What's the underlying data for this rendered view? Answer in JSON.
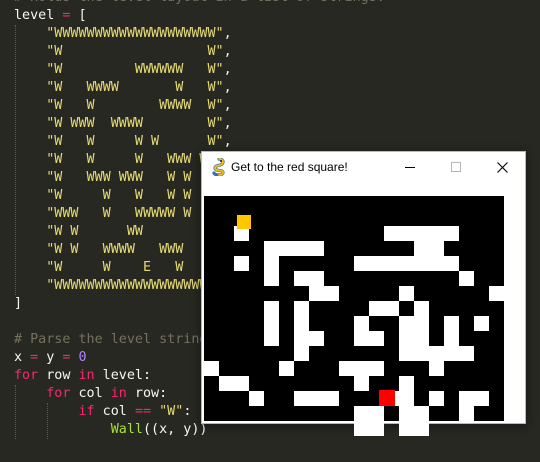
{
  "editor": {
    "lines": [
      {
        "indent": 0,
        "tokens": [
          {
            "t": "# Holds the level layout in a list of strings.",
            "c": "com"
          }
        ]
      },
      {
        "indent": 0,
        "tokens": [
          {
            "t": "level "
          },
          {
            "t": "=",
            "c": "kw"
          },
          {
            "t": " ["
          }
        ]
      },
      {
        "indent": 4,
        "tokens": [
          {
            "t": "\"WWWWWWWWWWWWWWWWWWWW\"",
            "c": "str"
          },
          {
            "t": ","
          }
        ]
      },
      {
        "indent": 4,
        "tokens": [
          {
            "t": "\"W                  W\"",
            "c": "str"
          },
          {
            "t": ","
          }
        ]
      },
      {
        "indent": 4,
        "tokens": [
          {
            "t": "\"W         WWWWWW   W\"",
            "c": "str"
          },
          {
            "t": ","
          }
        ]
      },
      {
        "indent": 4,
        "tokens": [
          {
            "t": "\"W   WWWW       W   W\"",
            "c": "str"
          },
          {
            "t": ","
          }
        ]
      },
      {
        "indent": 4,
        "tokens": [
          {
            "t": "\"W   W        WWWW  W\"",
            "c": "str"
          },
          {
            "t": ","
          }
        ]
      },
      {
        "indent": 4,
        "tokens": [
          {
            "t": "\"W WWW  WWWW        W\"",
            "c": "str"
          },
          {
            "t": ","
          }
        ]
      },
      {
        "indent": 4,
        "tokens": [
          {
            "t": "\"W   W     W W      W\"",
            "c": "str"
          },
          {
            "t": ","
          }
        ]
      },
      {
        "indent": 4,
        "tokens": [
          {
            "t": "\"W   W     W   WWW WW\"",
            "c": "str"
          },
          {
            "t": ","
          }
        ]
      },
      {
        "indent": 4,
        "tokens": [
          {
            "t": "\"W   WWW WWW   W W  W\"",
            "c": "str"
          },
          {
            "t": ","
          }
        ]
      },
      {
        "indent": 4,
        "tokens": [
          {
            "t": "\"W     W   W   W W  W\"",
            "c": "str"
          },
          {
            "t": ","
          }
        ]
      },
      {
        "indent": 4,
        "tokens": [
          {
            "t": "\"WWW   W   WWWWW W  W\"",
            "c": "str"
          },
          {
            "t": ","
          }
        ]
      },
      {
        "indent": 4,
        "tokens": [
          {
            "t": "\"W W      WW        W\"",
            "c": "str"
          },
          {
            "t": ","
          }
        ]
      },
      {
        "indent": 4,
        "tokens": [
          {
            "t": "\"W W   WWWW   WWW   W\"",
            "c": "str"
          },
          {
            "t": ","
          }
        ]
      },
      {
        "indent": 4,
        "tokens": [
          {
            "t": "\"W     W    E   W   W\"",
            "c": "str"
          },
          {
            "t": ","
          }
        ]
      },
      {
        "indent": 4,
        "tokens": [
          {
            "t": "\"WWWWWWWWWWWWWWWWWWWW\"",
            "c": "str"
          },
          {
            "t": ","
          }
        ]
      },
      {
        "indent": 0,
        "tokens": [
          {
            "t": "]"
          }
        ]
      },
      {
        "indent": 0,
        "tokens": []
      },
      {
        "indent": 0,
        "tokens": [
          {
            "t": "# Parse the level string above.",
            "c": "com"
          }
        ]
      },
      {
        "indent": 0,
        "tokens": [
          {
            "t": "x "
          },
          {
            "t": "=",
            "c": "kw"
          },
          {
            "t": " y "
          },
          {
            "t": "=",
            "c": "kw"
          },
          {
            "t": " "
          },
          {
            "t": "0",
            "c": "num"
          }
        ]
      },
      {
        "indent": 0,
        "tokens": [
          {
            "t": "for",
            "c": "kw"
          },
          {
            "t": " row "
          },
          {
            "t": "in",
            "c": "kw"
          },
          {
            "t": " level:"
          }
        ]
      },
      {
        "indent": 4,
        "tokens": [
          {
            "t": "for",
            "c": "kw"
          },
          {
            "t": " col "
          },
          {
            "t": "in",
            "c": "kw"
          },
          {
            "t": " row:"
          }
        ]
      },
      {
        "indent": 8,
        "tokens": [
          {
            "t": "if",
            "c": "kw"
          },
          {
            "t": " col "
          },
          {
            "t": "==",
            "c": "kw"
          },
          {
            "t": " "
          },
          {
            "t": "\"W\"",
            "c": "str"
          },
          {
            "t": ":"
          }
        ]
      },
      {
        "indent": 12,
        "tokens": [
          {
            "t": "Wall",
            "c": "fn"
          },
          {
            "t": "((x, y))"
          }
        ]
      }
    ]
  },
  "window": {
    "title": "Get to the red square!",
    "icon": "pygame-snake-icon",
    "minimize_icon": "minimize-icon",
    "maximize_icon": "maximize-icon",
    "close_icon": "close-icon"
  },
  "game": {
    "grid": [
      "....................",
      "....................",
      "..#.........#####...",
      "....####......##....",
      "..#.#.....#######...",
      "....#.##.........#..",
      ".......##....#.....#",
      "....#.#....##.#.....",
      "....#.#...#..##.#.#.",
      "....#.##..##.##.#...",
      "......#......#####..",
      "#....#...###...#....",
      ".##.......#..#......",
      "...#..###...##.#.##.",
      "..........##.##..#..",
      "..........##.##....."
    ],
    "player_color": "#ffc600",
    "goal_color": "#ff0000",
    "wall_color": "#ffffff",
    "background_color": "#000000"
  },
  "colors": {
    "editor_background": "#272822",
    "keyword": "#f92672",
    "string": "#e6db74",
    "number": "#ae81ff",
    "comment": "#75715e",
    "function": "#a6e22e",
    "default": "#f8f8f2"
  }
}
